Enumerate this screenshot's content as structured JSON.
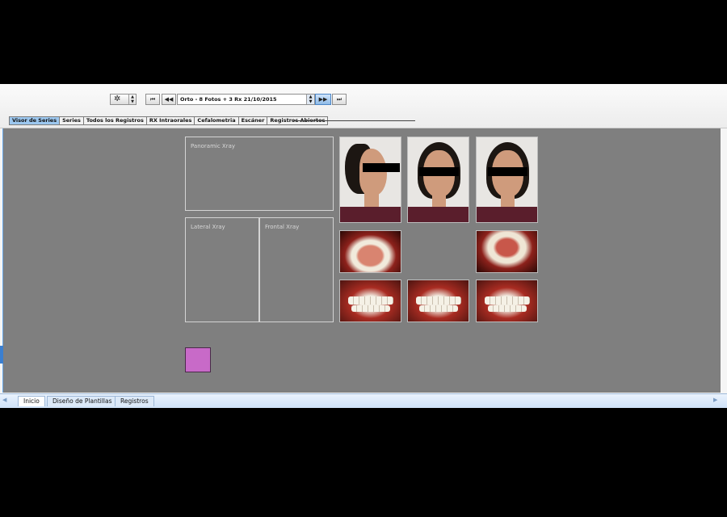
{
  "toolbar": {
    "series_select_value": "Orto - 8 Fotos + 3 Rx 21/10/2015",
    "icons": {
      "gear": "gear-icon",
      "first": "skip-first-icon",
      "prev": "rewind-icon",
      "next": "fast-forward-icon",
      "last": "skip-last-icon"
    }
  },
  "tabs": [
    {
      "label": "Visor de Series",
      "active": true
    },
    {
      "label": "Series",
      "active": false
    },
    {
      "label": "Todos los Registros",
      "active": false
    },
    {
      "label": "RX Intraorales",
      "active": false
    },
    {
      "label": "Cefalometria",
      "active": false
    },
    {
      "label": "Escáner",
      "active": false
    },
    {
      "label": "Registros Abiertos",
      "active": false
    }
  ],
  "xray_slots": {
    "panoramic": "Panoramic Xray",
    "lateral": "Lateral Xray",
    "frontal": "Frontal Xray"
  },
  "bottom_tabs": [
    {
      "label": "Inicio",
      "active": true
    },
    {
      "label": "Diseño de Plantillas",
      "active": false
    },
    {
      "label": "Registros",
      "active": false
    }
  ],
  "colors": {
    "workspace": "#7f7f7f",
    "swatch": "#c86ac8",
    "active_tab": "#9cc7ef"
  }
}
